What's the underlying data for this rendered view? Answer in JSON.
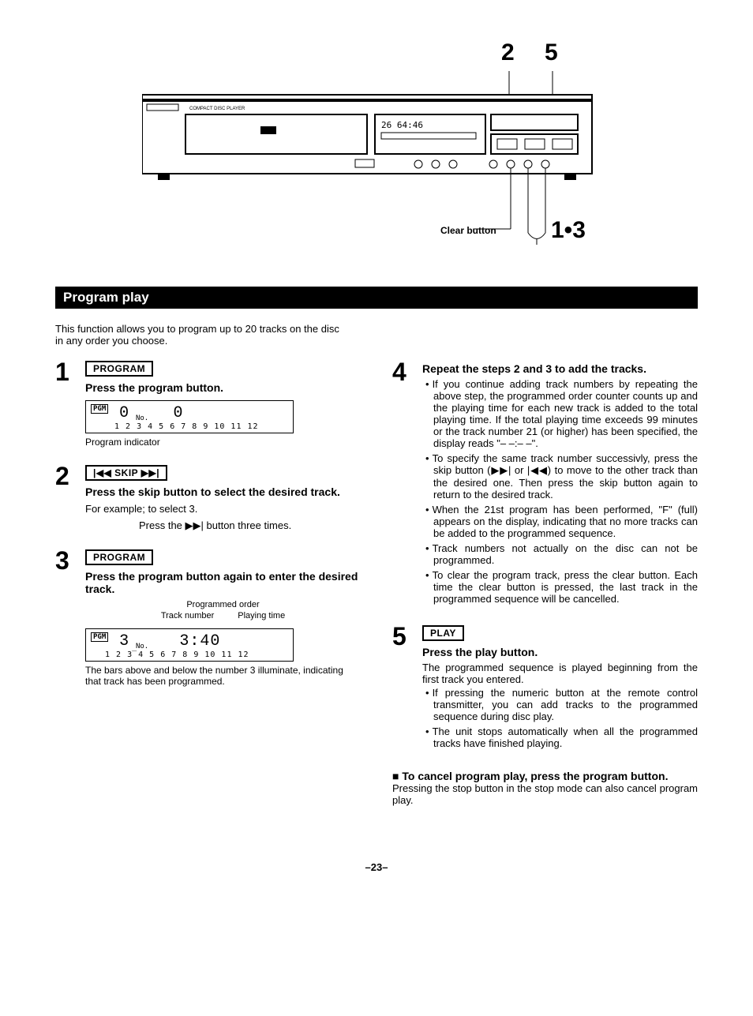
{
  "callouts": {
    "top_left": "2",
    "top_right": "5",
    "bottom": "1•3",
    "clear_button": "Clear button"
  },
  "device_label": "COMPACT DISC PLAYER",
  "section_title": "Program play",
  "intro": "This function allows you to program up to 20 tracks on the disc in any order you choose.",
  "step1": {
    "num": "1",
    "button": "PROGRAM",
    "title": "Press the program button.",
    "display_tracks": "1  2  3  4  5  6  7  8  9  10  11  12",
    "display_no": "No.",
    "display_pgm": "PGM",
    "display_seg_left": "0",
    "display_seg_right": "0",
    "caption": "Program indicator"
  },
  "step2": {
    "num": "2",
    "button": "|◀◀ SKIP ▶▶|",
    "title": "Press the skip button to select the desired track.",
    "example_a": "For example;  to select 3.",
    "example_b": "Press the ▶▶| button three times."
  },
  "step3": {
    "num": "3",
    "button": "PROGRAM",
    "title": "Press the program button again to enter the desired track.",
    "annot_top": "Programmed order",
    "annot_left": "Track number",
    "annot_right": "Playing time",
    "display_pgm": "PGM",
    "display_seg_left": "3",
    "display_seg_right": "3:40",
    "display_no": "No.",
    "display_tracks": "1  2  3̅  4  5  6  7  8  9  10  11  12",
    "caption": "The bars above and below the number 3 illuminate, indicating that track has been programmed."
  },
  "step4": {
    "num": "4",
    "title": "Repeat the steps 2 and 3 to add the tracks.",
    "bullets": [
      "If you continue adding track numbers by repeating the above step, the programmed order counter counts up and the playing time for each new track is added to the total playing time. If the total playing time exceeds 99 minutes or the track number 21 (or higher) has been specified, the display reads \"– –:– –\".",
      "To specify the same track number successivly, press the skip button (▶▶| or |◀◀) to move to the other track than the desired one. Then press the skip button again to return to the desired track.",
      "When the 21st program has been performed, \"F\" (full) appears on the display, indicating that no more tracks can be added to the programmed sequence.",
      "Track numbers not actually on the disc can not be programmed.",
      "To clear the program track, press the clear button. Each time the clear button is pressed, the last track in the programmed sequence will be cancelled."
    ]
  },
  "step5": {
    "num": "5",
    "button": "PLAY",
    "title": "Press the play button.",
    "desc": "The programmed sequence is played beginning from the first track you entered.",
    "bullets": [
      "If pressing the numeric button at the remote control transmitter, you can add tracks to the programmed sequence during disc play.",
      "The unit stops automatically when all the programmed tracks have finished playing."
    ]
  },
  "cancel": {
    "title": "To cancel program play, press the program button.",
    "desc": "Pressing the stop button in the stop mode can also cancel program play."
  },
  "page_number": "–23–"
}
